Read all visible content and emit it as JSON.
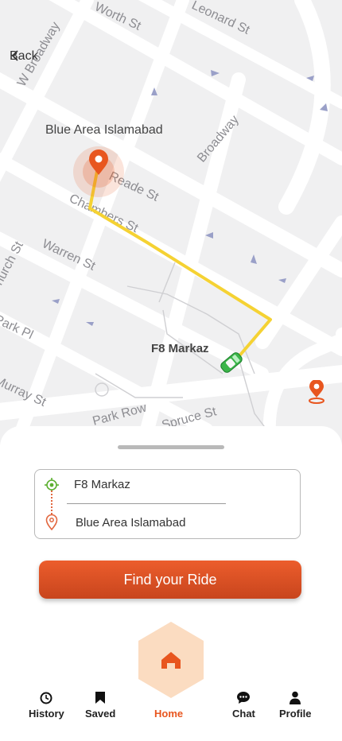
{
  "header": {
    "back_label": "Back"
  },
  "map": {
    "destination_label": "Blue Area Islamabad",
    "origin_label": "F8 Markaz",
    "streets": [
      "Worth St",
      "Leonard St",
      "W Broadway",
      "Broadway",
      "Reade St",
      "Chambers St",
      "Church St",
      "Warren St",
      "Park Pl",
      "Murray St",
      "Park Row",
      "Spruce St"
    ]
  },
  "route": {
    "from": "F8 Markaz",
    "to": "Blue Area Islamabad"
  },
  "find_button": {
    "label": "Find your Ride"
  },
  "nav": {
    "items": [
      {
        "label": "History",
        "icon": "history-icon"
      },
      {
        "label": "Saved",
        "icon": "bookmark-icon"
      },
      {
        "label": "Home",
        "icon": "home-icon",
        "active": true
      },
      {
        "label": "Chat",
        "icon": "chat-icon"
      },
      {
        "label": "Profile",
        "icon": "profile-icon"
      }
    ]
  },
  "colors": {
    "accent": "#e8561f",
    "route": "#f5d233",
    "car": "#3cb54a",
    "map_bg": "#f0f0f1"
  }
}
